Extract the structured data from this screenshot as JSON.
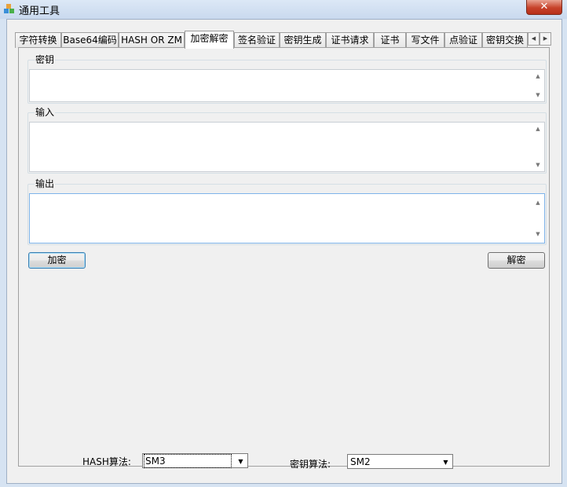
{
  "window": {
    "title": "通用工具",
    "close_symbol": "✕"
  },
  "tabs": [
    {
      "label": "字符转换"
    },
    {
      "label": "Base64编码"
    },
    {
      "label": "HASH OR ZM"
    },
    {
      "label": "加密解密",
      "active": true
    },
    {
      "label": "签名验证"
    },
    {
      "label": "密钥生成"
    },
    {
      "label": "证书请求"
    },
    {
      "label": "证书"
    },
    {
      "label": "写文件"
    },
    {
      "label": "点验证"
    },
    {
      "label": "密钥交换"
    }
  ],
  "tab_scroll": {
    "left": "◀",
    "right": "▶"
  },
  "panel": {
    "key_group": {
      "label": "密钥",
      "value": ""
    },
    "input_group": {
      "label": "输入",
      "value": ""
    },
    "output_group": {
      "label": "输出",
      "value": ""
    },
    "encrypt_button": "加密",
    "decrypt_button": "解密"
  },
  "bottom": {
    "hash_label": "HASH算法:",
    "hash_value": "SM3",
    "key_algo_label": "密钥算法:",
    "key_algo_value": "SM2"
  },
  "scroll_arrows": {
    "up": "▲",
    "down": "▼"
  },
  "dropdown_arrow": "▼"
}
